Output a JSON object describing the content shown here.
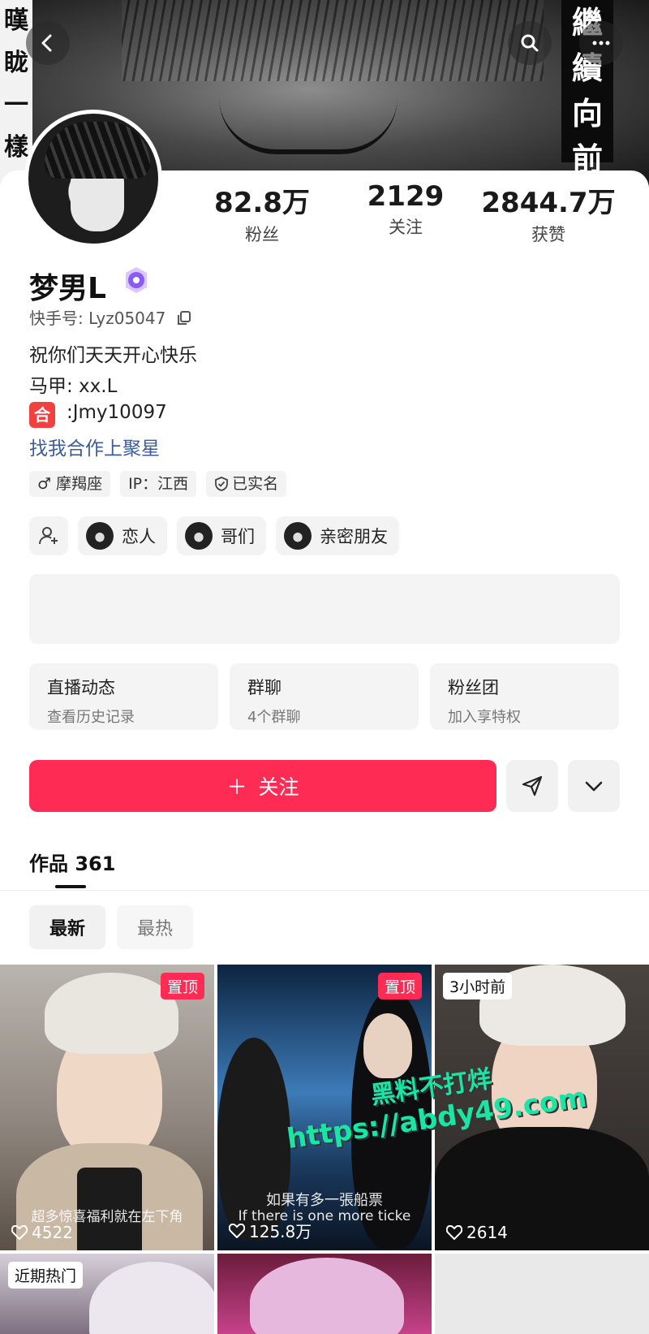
{
  "banner": {
    "left_text": [
      "暵",
      "眬",
      "一",
      "樣"
    ],
    "right_text": [
      "繼",
      "續",
      "向",
      "前"
    ]
  },
  "stats": [
    {
      "value": "82.8万",
      "label": "粉丝"
    },
    {
      "value": "2129",
      "label": "关注"
    },
    {
      "value": "2844.7万",
      "label": "获赞"
    }
  ],
  "profile": {
    "name": "梦男L",
    "kuaishou_id": "快手号: Lyz05047",
    "bio_lines": [
      "祝你们天天开心快乐",
      "马甲: xx.L"
    ],
    "he_badge": "合",
    "he_text": ":Jmy10097",
    "link_text": "找我合作上聚星"
  },
  "tags": [
    "♂ 摩羯座",
    "IP：江西",
    "已实名"
  ],
  "relations": [
    "恋人",
    "哥们",
    "亲密朋友"
  ],
  "features": [
    {
      "title": "直播动态",
      "sub": "查看历史记录"
    },
    {
      "title": "群聊",
      "sub": "4个群聊"
    },
    {
      "title": "粉丝团",
      "sub": "加入享特权"
    }
  ],
  "actions": {
    "follow_label": "关注",
    "follow_plus": "＋"
  },
  "works": {
    "label": "作品 361"
  },
  "sort": {
    "newest": "最新",
    "hottest": "最热"
  },
  "videos": [
    {
      "badge": "置顶",
      "caption": "超多惊喜福利就在左下角",
      "likes": "4522"
    },
    {
      "badge": "置顶",
      "caption": "如果有多一張船票",
      "caption2": "If there is one more ticke",
      "likes": "125.8万"
    },
    {
      "time": "3小时前",
      "likes": "2614"
    },
    {
      "time": "近期热门"
    },
    {}
  ],
  "watermark": {
    "line1": "黑料不打烊",
    "line2": "https://abdy49.com"
  },
  "colors": {
    "accent": "#fe2c55",
    "link": "#3b5c99",
    "watermark": "#19e6a4"
  }
}
